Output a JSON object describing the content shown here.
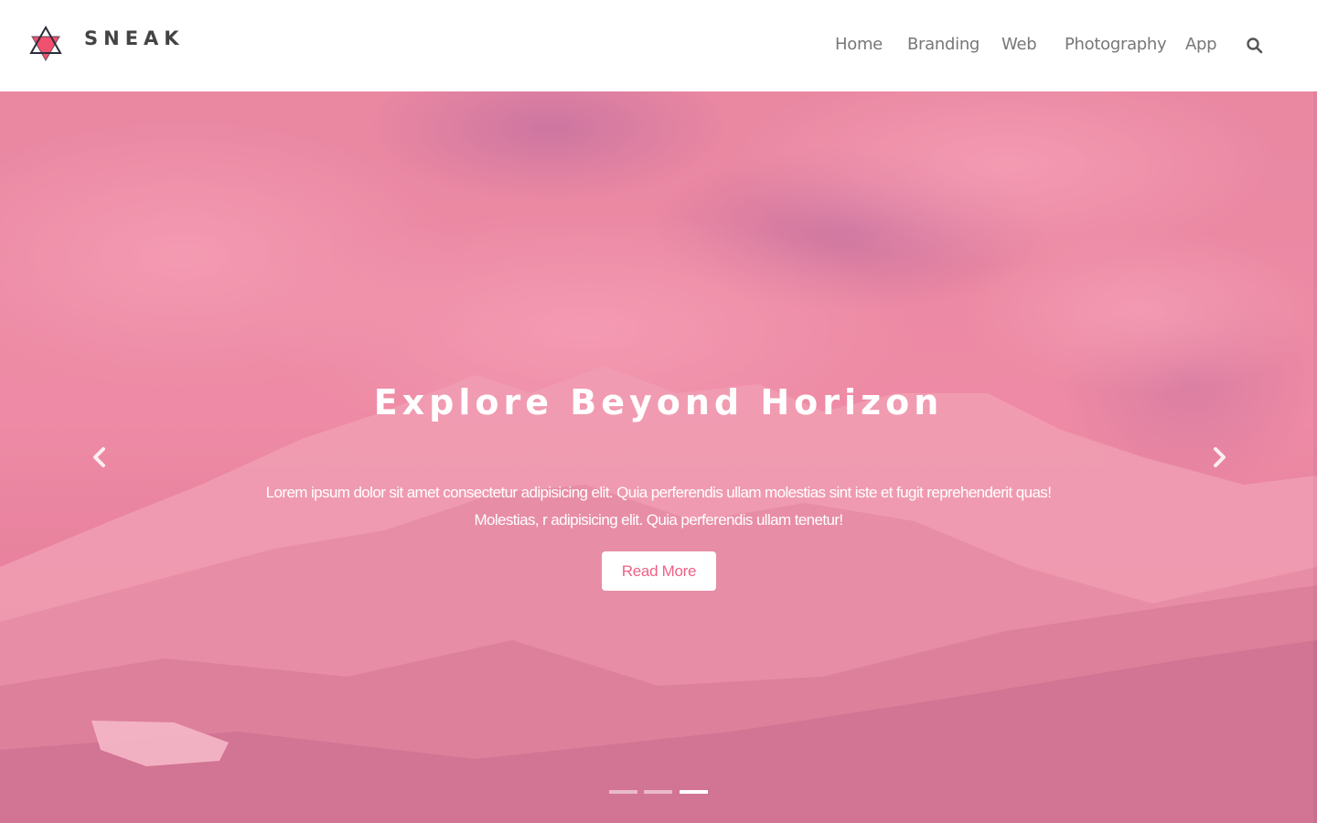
{
  "brand": {
    "name": "SNEAK",
    "accent": "#f0516f",
    "outline": "#2d2d3a"
  },
  "nav": {
    "items": [
      {
        "label": "Home"
      },
      {
        "label": "Branding"
      },
      {
        "label": "Web"
      },
      {
        "label": "Photography"
      },
      {
        "label": "App"
      }
    ],
    "search_icon": "search-icon"
  },
  "hero": {
    "title": "Explore Beyond Horizon",
    "text_line1": "Lorem ipsum dolor sit amet consectetur adipisicing elit. Quia perferendis ullam molestias sint iste et fugit reprehenderit quas!",
    "text_line2": "Molestias, r adipisicing elit. Quia perferendis ullam tenetur!",
    "button_label": "Read More",
    "overlay_color": "#ee7f9e",
    "prev_icon": "chevron-left-icon",
    "next_icon": "chevron-right-icon",
    "slides": [
      {
        "active": false
      },
      {
        "active": false
      },
      {
        "active": true
      }
    ]
  }
}
